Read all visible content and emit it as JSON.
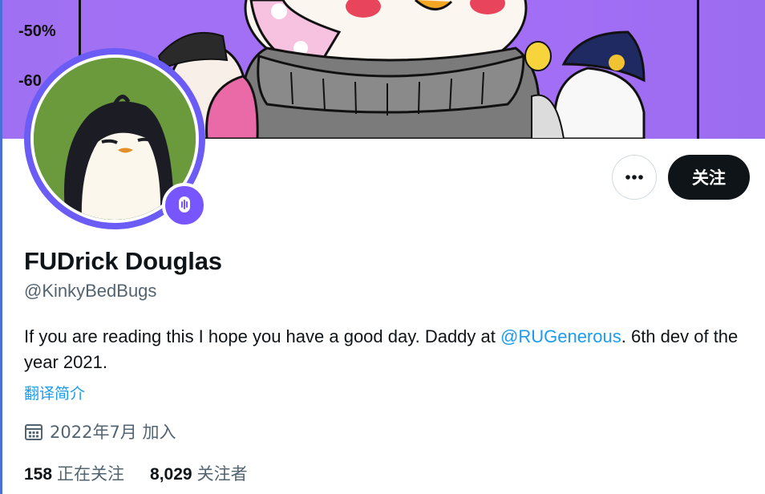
{
  "banner": {
    "ticks": [
      "-50%",
      "-60"
    ]
  },
  "profile": {
    "display_name": "FUDrick Douglas",
    "handle": "@KinkyBedBugs",
    "bio_before": "If you are reading this I hope you have a good day. Daddy at ",
    "bio_mention": "@RUGenerous",
    "bio_after": ". 6th dev of the year 2021.",
    "translate_label": "翻译简介",
    "joined_text": "2022年7月 加入",
    "following_count": "158",
    "following_label": "正在关注",
    "followers_count": "8,029",
    "followers_label": "关注者"
  },
  "actions": {
    "more_label": "···",
    "follow_label": "关注"
  },
  "icons": {
    "more": "more-icon",
    "calendar": "calendar-icon",
    "spaces": "spaces-mic-icon"
  },
  "colors": {
    "accent_link": "#1d9bf0",
    "follow_bg": "#0f1419",
    "banner_purple": "#a56ff7",
    "avatar_ring": "#6b5cf6",
    "badge": "#7856ff"
  }
}
